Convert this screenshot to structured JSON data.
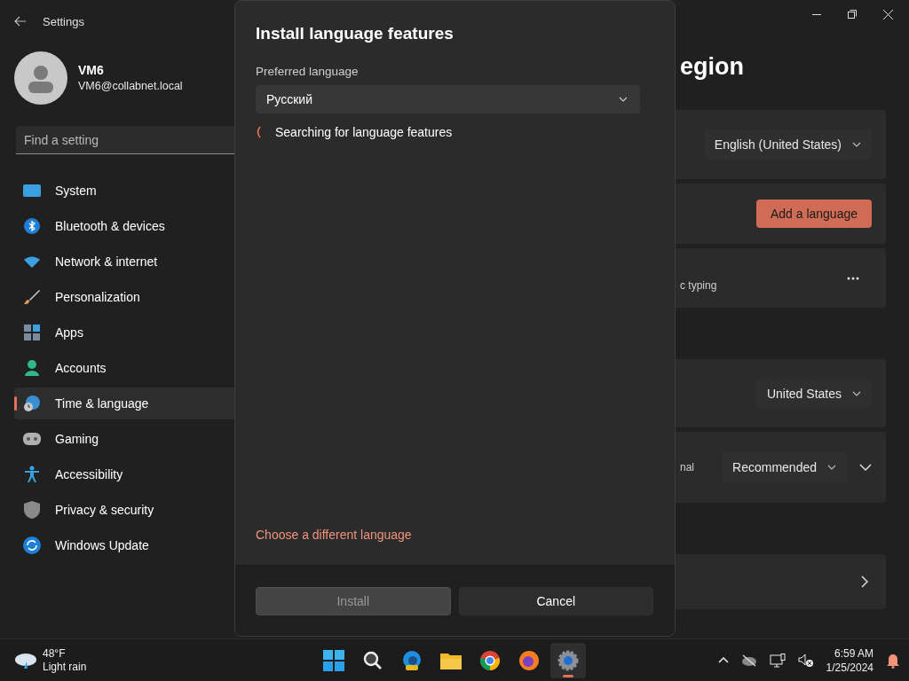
{
  "settings_window": {
    "title": "Settings"
  },
  "account": {
    "name": "VM6",
    "email": "VM6@collabnet.local"
  },
  "search": {
    "placeholder": "Find a setting"
  },
  "nav": [
    {
      "label": "System",
      "selected": false
    },
    {
      "label": "Bluetooth & devices",
      "selected": false
    },
    {
      "label": "Network & internet",
      "selected": false
    },
    {
      "label": "Personalization",
      "selected": false
    },
    {
      "label": "Apps",
      "selected": false
    },
    {
      "label": "Accounts",
      "selected": false
    },
    {
      "label": "Time & language",
      "selected": true
    },
    {
      "label": "Gaming",
      "selected": false
    },
    {
      "label": "Accessibility",
      "selected": false
    },
    {
      "label": "Privacy & security",
      "selected": false
    },
    {
      "label": "Windows Update",
      "selected": false
    }
  ],
  "page": {
    "title": "egion",
    "sections": [
      {
        "cards": [
          {
            "kind": "dropdown",
            "value": "English (United States)"
          },
          {
            "kind": "button",
            "label": "Add a language"
          },
          {
            "kind": "more",
            "text": "c typing"
          }
        ]
      },
      {
        "cards": [
          {
            "kind": "dropdown",
            "value": "United States"
          },
          {
            "kind": "dropdown_expand",
            "text": "nal",
            "value": "Recommended"
          }
        ]
      },
      {
        "cards": [
          {
            "kind": "link"
          }
        ]
      }
    ]
  },
  "dialog": {
    "title": "Install language features",
    "field_label": "Preferred language",
    "select_value": "Русский",
    "status": "Searching for language features",
    "link": "Choose a different language",
    "buttons": [
      {
        "label": "Install",
        "disabled": true
      },
      {
        "label": "Cancel",
        "disabled": false
      }
    ]
  },
  "taskbar": {
    "weather": {
      "temp": "48°F",
      "condition": "Light rain"
    },
    "apps": [
      {
        "selected": false
      },
      {
        "selected": false
      },
      {
        "selected": false
      },
      {
        "selected": false
      },
      {
        "selected": false
      },
      {
        "selected": false
      },
      {
        "selected": true
      }
    ],
    "clock": {
      "time": "6:59 AM",
      "date": "1/25/2024"
    }
  }
}
